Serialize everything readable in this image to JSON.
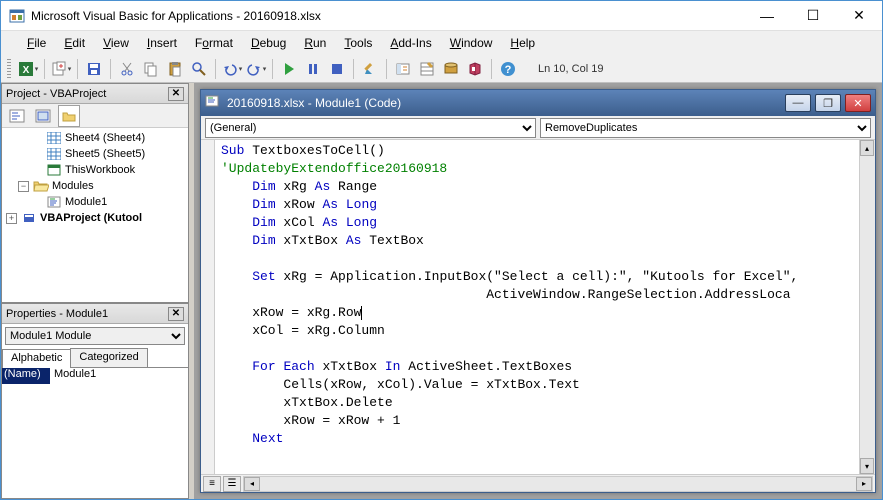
{
  "window": {
    "title": "Microsoft Visual Basic for Applications - 20160918.xlsx"
  },
  "menubar": [
    {
      "u": "F",
      "rest": "ile"
    },
    {
      "u": "E",
      "rest": "dit"
    },
    {
      "u": "V",
      "rest": "iew"
    },
    {
      "u": "I",
      "rest": "nsert"
    },
    {
      "u": "",
      "rest": "F",
      "after": "o",
      "u2": "",
      "raw": "F<u>o</u>rmat"
    },
    {
      "u": "D",
      "rest": "ebug"
    },
    {
      "u": "R",
      "rest": "un"
    },
    {
      "u": "T",
      "rest": "ools"
    },
    {
      "u": "A",
      "rest": "dd-Ins"
    },
    {
      "u": "W",
      "rest": "indow"
    },
    {
      "u": "H",
      "rest": "elp"
    }
  ],
  "menus": {
    "file": "File",
    "edit": "Edit",
    "view": "View",
    "insert": "Insert",
    "format": "Format",
    "debug": "Debug",
    "run": "Run",
    "tools": "Tools",
    "addins": "Add-Ins",
    "window": "Window",
    "help": "Help"
  },
  "status": "Ln 10, Col 19",
  "project_panel": {
    "title": "Project - VBAProject",
    "tree": {
      "sheet4": "Sheet4 (Sheet4)",
      "sheet5": "Sheet5 (Sheet5)",
      "thiswb": "ThisWorkbook",
      "modules": "Modules",
      "module1": "Module1",
      "kutool": "VBAProject (Kutool"
    }
  },
  "properties_panel": {
    "title": "Properties - Module1",
    "dropdown": "Module1 Module",
    "tabs": {
      "alpha": "Alphabetic",
      "cat": "Categorized"
    },
    "row_name_key": "(Name)",
    "row_name_val": "Module1"
  },
  "mdi": {
    "title": "20160918.xlsx - Module1 (Code)",
    "dd_left": "(General)",
    "dd_right": "RemoveDuplicates"
  },
  "code": {
    "l1_a": "Sub",
    "l1_b": " TextboxesToCell()",
    "l2": "'UpdatebyExtendoffice20160918",
    "l3_a": "Dim",
    "l3_b": " xRg ",
    "l3_c": "As",
    "l3_d": " Range",
    "l4_a": "Dim",
    "l4_b": " xRow ",
    "l4_c": "As",
    "l4_d": " ",
    "l4_e": "Long",
    "l5_a": "Dim",
    "l5_b": " xCol ",
    "l5_c": "As",
    "l5_d": " ",
    "l5_e": "Long",
    "l6_a": "Dim",
    "l6_b": " xTxtBox ",
    "l6_c": "As",
    "l6_d": " TextBox",
    "l8_a": "Set",
    "l8_b": " xRg = Application.InputBox(\"Select a cell):\", \"Kutools for Excel\",",
    "l9": "                                  ActiveWindow.RangeSelection.AddressLoca",
    "l10": "    xRow = xRg.Row",
    "l11": "    xCol = xRg.Column",
    "l13_a": "For",
    "l13_b": " ",
    "l13_c": "Each",
    "l13_d": " xTxtBox ",
    "l13_e": "In",
    "l13_f": " ActiveSheet.TextBoxes",
    "l14": "        Cells(xRow, xCol).Value = xTxtBox.Text",
    "l15": "        xTxtBox.Delete",
    "l16": "        xRow = xRow + 1",
    "l17": "Next"
  }
}
